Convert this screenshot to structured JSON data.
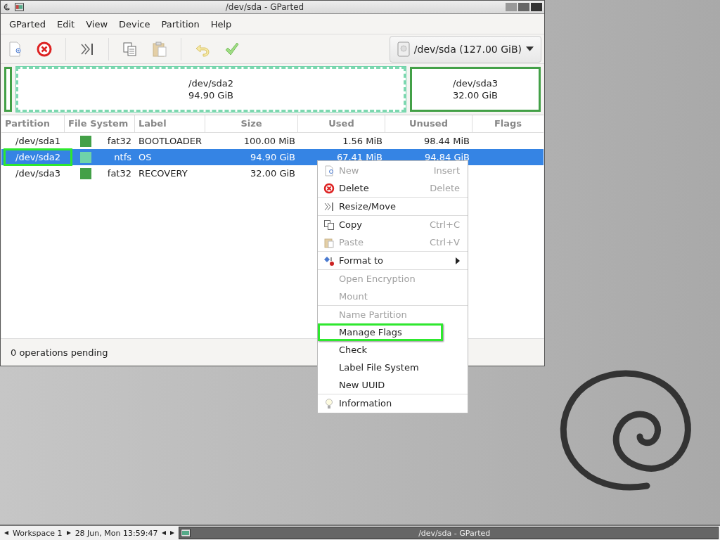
{
  "window": {
    "title": "/dev/sda - GParted"
  },
  "menubar": [
    "GParted",
    "Edit",
    "View",
    "Device",
    "Partition",
    "Help"
  ],
  "device_selector": {
    "value": "/dev/sda (127.00 GiB)"
  },
  "partition_graph": [
    {
      "kind": "sliver",
      "selected": false
    },
    {
      "kind": "block",
      "name": "/dev/sda2",
      "size": "94.90 GiB",
      "selected": true
    },
    {
      "kind": "block",
      "name": "/dev/sda3",
      "size": "32.00 GiB",
      "selected": false
    }
  ],
  "table": {
    "columns": [
      "Partition",
      "File System",
      "Label",
      "Size",
      "Used",
      "Unused",
      "Flags"
    ],
    "rows": [
      {
        "partition": "/dev/sda1",
        "color": "#43a047",
        "file_system": "fat32",
        "label": "BOOTLOADER",
        "size": "100.00 MiB",
        "used": "1.56 MiB",
        "unused": "98.44 MiB",
        "selected": false,
        "highlighted": false
      },
      {
        "partition": "/dev/sda2",
        "color": "#6fd3a9",
        "file_system": "ntfs",
        "label": "OS",
        "size": "94.90 GiB",
        "used": "67.41 MiB",
        "unused": "94.84 GiB",
        "selected": true,
        "highlighted": true
      },
      {
        "partition": "/dev/sda3",
        "color": "#43a047",
        "file_system": "fat32",
        "label": "RECOVERY",
        "size": "32.00 GiB",
        "selected": false,
        "highlighted": false
      }
    ]
  },
  "status_bar": "0 operations pending",
  "context_menu": [
    {
      "kind": "item",
      "label": "New",
      "shortcut": "Insert",
      "disabled": true,
      "highlighted": false
    },
    {
      "kind": "item",
      "label": "Delete",
      "shortcut": "Delete",
      "disabled": false,
      "highlighted": false
    },
    {
      "kind": "separator"
    },
    {
      "kind": "item",
      "label": "Resize/Move",
      "disabled": false,
      "highlighted": false
    },
    {
      "kind": "separator"
    },
    {
      "kind": "item",
      "label": "Copy",
      "shortcut": "Ctrl+C",
      "disabled": false,
      "highlighted": false
    },
    {
      "kind": "item",
      "label": "Paste",
      "shortcut": "Ctrl+V",
      "disabled": true,
      "highlighted": false
    },
    {
      "kind": "separator"
    },
    {
      "kind": "item",
      "label": "Format to",
      "submenu": true,
      "disabled": false,
      "highlighted": false
    },
    {
      "kind": "separator"
    },
    {
      "kind": "item",
      "label": "Open Encryption",
      "disabled": true,
      "highlighted": false
    },
    {
      "kind": "item",
      "label": "Mount",
      "disabled": true,
      "highlighted": false
    },
    {
      "kind": "separator"
    },
    {
      "kind": "item",
      "label": "Name Partition",
      "disabled": true,
      "highlighted": false
    },
    {
      "kind": "item",
      "label": "Manage Flags",
      "disabled": false,
      "highlighted": true
    },
    {
      "kind": "item",
      "label": "Check",
      "disabled": false,
      "highlighted": false
    },
    {
      "kind": "item",
      "label": "Label File System",
      "disabled": false,
      "highlighted": false
    },
    {
      "kind": "item",
      "label": "New UUID",
      "disabled": false,
      "highlighted": false
    },
    {
      "kind": "separator"
    },
    {
      "kind": "item",
      "label": "Information",
      "disabled": false,
      "highlighted": false
    }
  ],
  "taskbar": {
    "workspace": "Workspace 1",
    "clock": "28 Jun, Mon 13:59:47",
    "task": "/dev/sda - GParted"
  }
}
